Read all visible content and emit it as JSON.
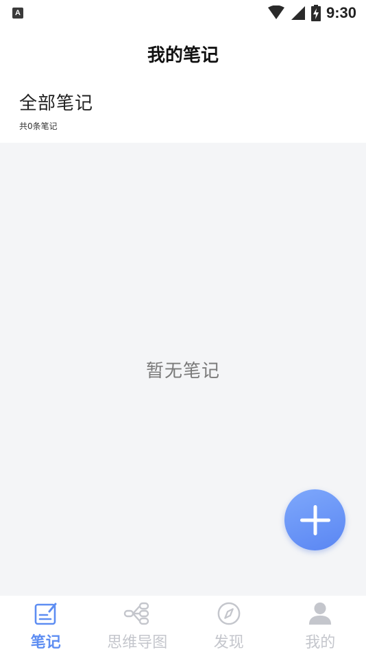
{
  "status_bar": {
    "time": "9:30",
    "left_icon": "A",
    "icons": [
      "wifi-icon",
      "cell-signal-icon",
      "battery-charging-icon"
    ]
  },
  "header": {
    "title": "我的笔记"
  },
  "section": {
    "title": "全部笔记",
    "count_text": "共0条笔记"
  },
  "empty_state": {
    "text": "暂无笔记"
  },
  "fab": {
    "icon": "plus-icon"
  },
  "tabs": [
    {
      "label": "笔记",
      "icon": "note-edit-icon",
      "active": true
    },
    {
      "label": "思维导图",
      "icon": "mindmap-icon",
      "active": false
    },
    {
      "label": "发现",
      "icon": "compass-icon",
      "active": false
    },
    {
      "label": "我的",
      "icon": "person-icon",
      "active": false
    }
  ],
  "colors": {
    "accent": "#5d8df2",
    "inactive": "#c4c6cc",
    "content_bg": "#f4f5f7",
    "fab_gradient_start": "#7ea8fb",
    "fab_gradient_end": "#5a86f3"
  }
}
